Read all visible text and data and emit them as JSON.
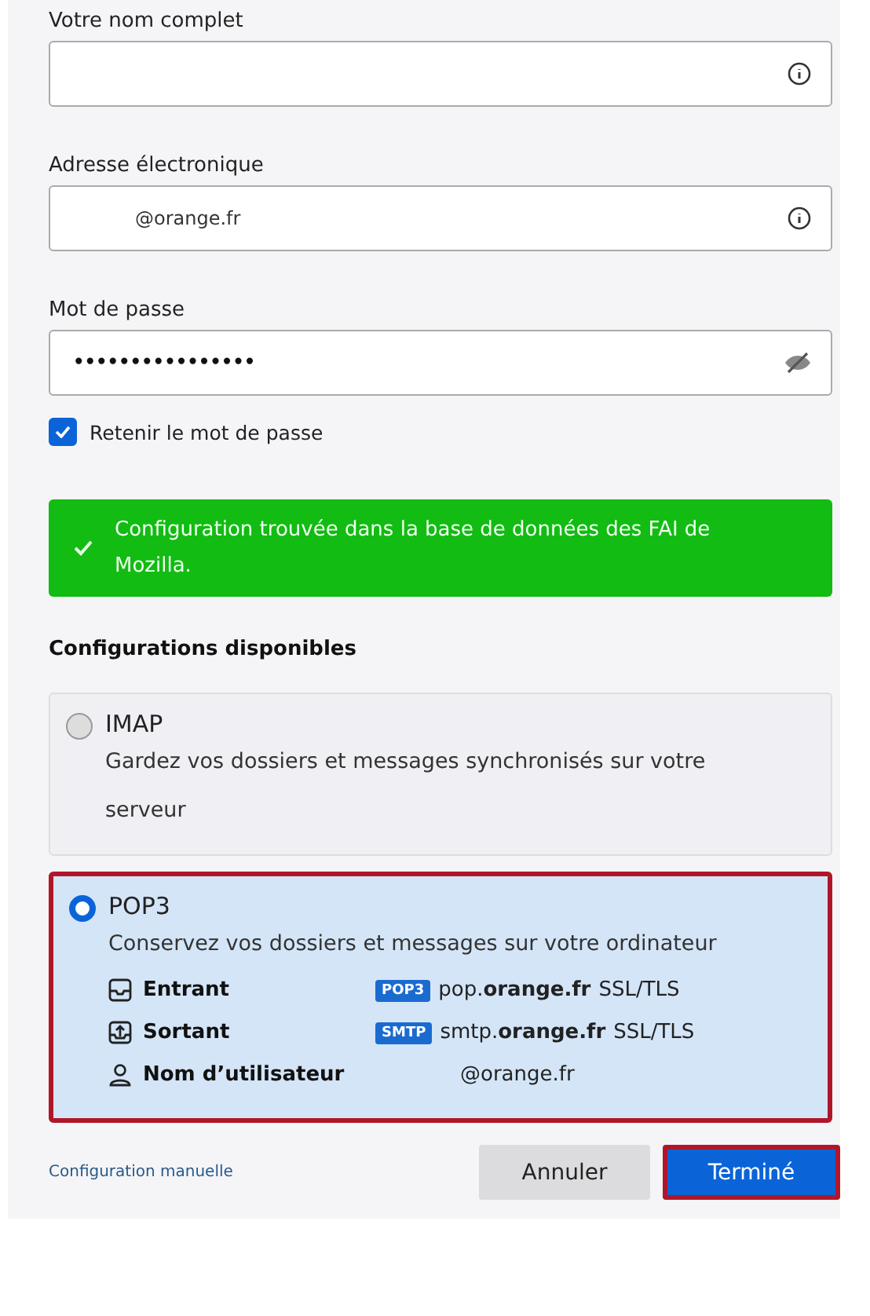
{
  "fields": [
    {
      "label": "Votre nom complet",
      "kind": "info"
    },
    {
      "label": "Adresse électronique",
      "value": "@orange.fr",
      "kind": "info"
    },
    {
      "label": "Mot de passe",
      "value": "••••••••••••••••",
      "kind": "password"
    }
  ],
  "remember": {
    "label": "Retenir le mot de passe",
    "checked": true
  },
  "banner": {
    "text": "Configuration trouvée dans la base de données des FAI de Mozilla."
  },
  "heading": "Configurations disponibles",
  "configs": [
    {
      "name": "IMAP",
      "description": "Gardez vos dossiers et messages synchronisés sur votre serveur",
      "selected": false,
      "highlighted": false
    },
    {
      "name": "POP3",
      "description": "Conservez vos dossiers et messages sur votre ordinateur",
      "selected": true,
      "highlighted": true,
      "details": [
        {
          "kind": "incoming",
          "label": "Entrant",
          "tag": "POP3",
          "server": "pop.**orange.fr**",
          "security": "SSL/TLS"
        },
        {
          "kind": "outgoing",
          "label": "Sortant",
          "tag": "SMTP",
          "server": "smtp.**orange.fr**",
          "security": "SSL/TLS"
        },
        {
          "kind": "user",
          "label": "Nom d’utilisateur",
          "server": "@orange.fr"
        }
      ]
    }
  ],
  "footer": {
    "link": "Configuration manuelle",
    "buttons": [
      {
        "label": "Annuler",
        "kind": "secondary",
        "highlighted": false
      },
      {
        "label": "Terminé",
        "kind": "primary",
        "highlighted": true
      }
    ]
  }
}
